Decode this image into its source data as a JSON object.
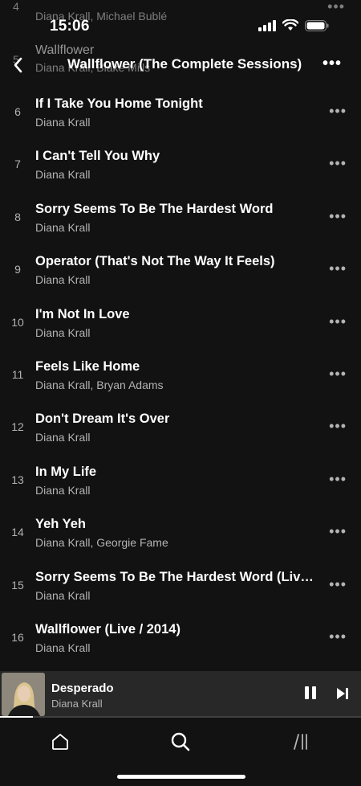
{
  "status": {
    "time": "15:06"
  },
  "header": {
    "title": "Wallflower (The Complete Sessions)",
    "back_icon": "chevron-left-icon",
    "more_icon": "ellipsis-icon"
  },
  "scrolled_under": [
    {
      "number": "4",
      "artist": "Diana Krall, Michael Bublé"
    },
    {
      "number": "5",
      "title": "Wallflower",
      "artist": "Diana Krall, Blake Mills"
    }
  ],
  "tracks": [
    {
      "number": "6",
      "title": "If I Take You Home Tonight",
      "artist": "Diana Krall"
    },
    {
      "number": "7",
      "title": "I Can't Tell You Why",
      "artist": "Diana Krall"
    },
    {
      "number": "8",
      "title": "Sorry Seems To Be The Hardest Word",
      "artist": "Diana Krall"
    },
    {
      "number": "9",
      "title": "Operator (That's Not The Way It Feels)",
      "artist": "Diana Krall"
    },
    {
      "number": "10",
      "title": "I'm Not In Love",
      "artist": "Diana Krall"
    },
    {
      "number": "11",
      "title": "Feels Like Home",
      "artist": "Diana Krall, Bryan Adams"
    },
    {
      "number": "12",
      "title": "Don't Dream It's Over",
      "artist": "Diana Krall"
    },
    {
      "number": "13",
      "title": "In My Life",
      "artist": "Diana Krall"
    },
    {
      "number": "14",
      "title": "Yeh Yeh",
      "artist": "Diana Krall, Georgie Fame"
    },
    {
      "number": "15",
      "title": "Sorry Seems To Be The Hardest Word (Live...",
      "artist": "Diana Krall"
    },
    {
      "number": "16",
      "title": "Wallflower (Live / 2014)",
      "artist": "Diana Krall"
    }
  ],
  "now_playing": {
    "title": "Desperado",
    "artist": "Diana Krall",
    "progress": 0.09,
    "pause_icon": "pause-icon",
    "next_icon": "skip-next-icon"
  },
  "tabs": [
    {
      "name": "home",
      "icon": "home-icon"
    },
    {
      "name": "search",
      "icon": "search-icon"
    },
    {
      "name": "library",
      "icon": "library-icon"
    }
  ],
  "colors": {
    "background": "#121212",
    "secondary_text": "#b3b3b3",
    "mini_player": "#282828"
  }
}
